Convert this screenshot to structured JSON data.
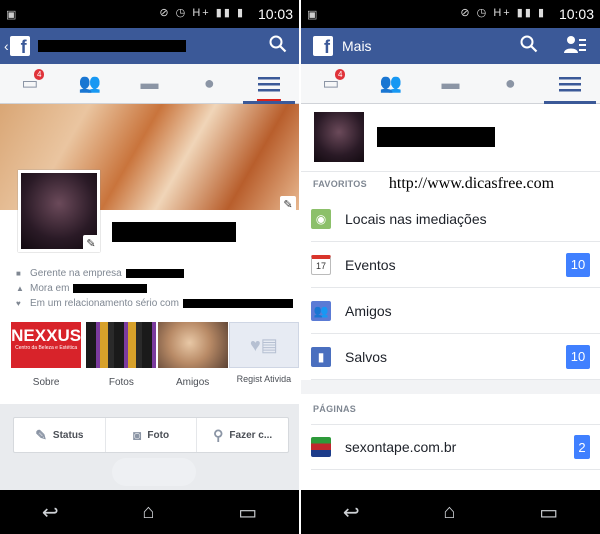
{
  "left": {
    "status": {
      "time": "10:03",
      "signal": "H+"
    },
    "tab_badge": "4",
    "info": {
      "work_prefix": "Gerente na empresa",
      "lives_prefix": "Mora em",
      "relationship_prefix": "Em um relacionamento sério com"
    },
    "thumbs": [
      {
        "label": "Sobre",
        "img_text": "NEXXUS",
        "img_sub": "Centro da Beleza e Estética"
      },
      {
        "label": "Fotos"
      },
      {
        "label": "Amigos"
      },
      {
        "label": "Regist Ativida"
      }
    ],
    "actions": [
      {
        "label": "Status",
        "icon": "edit-icon"
      },
      {
        "label": "Foto",
        "icon": "camera-icon"
      },
      {
        "label": "Fazer c...",
        "icon": "location-icon"
      }
    ]
  },
  "right": {
    "status": {
      "time": "10:03",
      "signal": "H+"
    },
    "header_title": "Mais",
    "tab_badge": "4",
    "watermark": "http://www.dicasfree.com",
    "favorites_label": "FAVORITOS",
    "favorites": [
      {
        "label": "Locais nas imediações",
        "icon": "map-pin-icon",
        "color": "#8cc06a"
      },
      {
        "label": "Eventos",
        "icon": "calendar-icon",
        "count": "10",
        "icon_text": "17"
      },
      {
        "label": "Amigos",
        "icon": "friends-icon",
        "color": "#5b7bd5"
      },
      {
        "label": "Salvos",
        "icon": "bookmark-icon",
        "count": "10",
        "color": "#4a6fbf"
      }
    ],
    "pages_label": "PÁGINAS",
    "pages": [
      {
        "label": "sexontape.com.br",
        "count": "2"
      }
    ]
  },
  "colors": {
    "brand": "#3b5998",
    "badge_red": "#e0333a",
    "count_blue": "#4080ff"
  }
}
